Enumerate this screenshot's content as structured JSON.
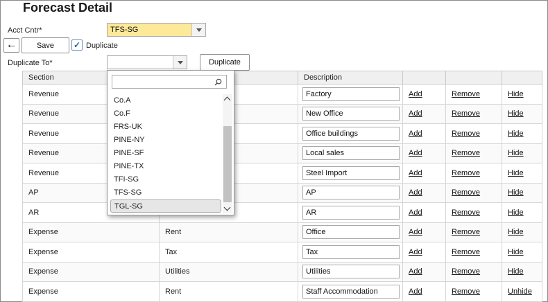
{
  "page": {
    "title": "Forecast Detail"
  },
  "form": {
    "acct_cntr_label": "Acct Cntr*",
    "acct_cntr_value": "TFS-SG",
    "save_label": "Save",
    "duplicate_checkbox_label": "Duplicate",
    "duplicate_checked": true,
    "duplicate_to_label": "Duplicate To*",
    "duplicate_to_value": "",
    "duplicate_button_label": "Duplicate",
    "back_glyph": "←",
    "check_glyph": "✓"
  },
  "dropdown": {
    "search_value": "",
    "items": [
      "Co.A",
      "Co.F",
      "FRS-UK",
      "PINE-NY",
      "PINE-SF",
      "PINE-TX",
      "TFI-SG",
      "TFS-SG",
      "TGL-SG"
    ],
    "selected": "TGL-SG"
  },
  "table": {
    "headers": {
      "section": "Section",
      "description": "Description"
    },
    "rows": [
      {
        "section": "Revenue",
        "sub": "",
        "description": "Factory",
        "add": "Add",
        "remove": "Remove",
        "toggle": "Hide"
      },
      {
        "section": "Revenue",
        "sub": "",
        "description": "New Office",
        "add": "Add",
        "remove": "Remove",
        "toggle": "Hide"
      },
      {
        "section": "Revenue",
        "sub": "",
        "description": "Office buildings",
        "add": "Add",
        "remove": "Remove",
        "toggle": "Hide"
      },
      {
        "section": "Revenue",
        "sub": "",
        "description": "Local sales",
        "add": "Add",
        "remove": "Remove",
        "toggle": "Hide"
      },
      {
        "section": "Revenue",
        "sub": "",
        "description": "Steel Import",
        "add": "Add",
        "remove": "Remove",
        "toggle": "Hide"
      },
      {
        "section": "AP",
        "sub": "",
        "description": "AP",
        "add": "Add",
        "remove": "Remove",
        "toggle": "Hide"
      },
      {
        "section": "AR",
        "sub": "",
        "description": "AR",
        "add": "Add",
        "remove": "Remove",
        "toggle": "Hide"
      },
      {
        "section": "Expense",
        "sub": "Rent",
        "description": "Office",
        "add": "Add",
        "remove": "Remove",
        "toggle": "Hide"
      },
      {
        "section": "Expense",
        "sub": "Tax",
        "description": "Tax",
        "add": "Add",
        "remove": "Remove",
        "toggle": "Hide"
      },
      {
        "section": "Expense",
        "sub": "Utilities",
        "description": "Utilities",
        "add": "Add",
        "remove": "Remove",
        "toggle": "Hide"
      },
      {
        "section": "Expense",
        "sub": "Rent",
        "description": "Staff Accommodation",
        "add": "Add",
        "remove": "Remove",
        "toggle": "Unhide"
      }
    ]
  },
  "colors": {
    "acct_cntr_bg": "#fde99a",
    "header_bg": "#f0f0f0",
    "checkbox_accent": "#2a5f9e"
  },
  "icons": {
    "back": "back-arrow-icon",
    "search": "search-icon",
    "dropdown": "chevron-down-icon",
    "checkbox": "checkmark-icon"
  }
}
